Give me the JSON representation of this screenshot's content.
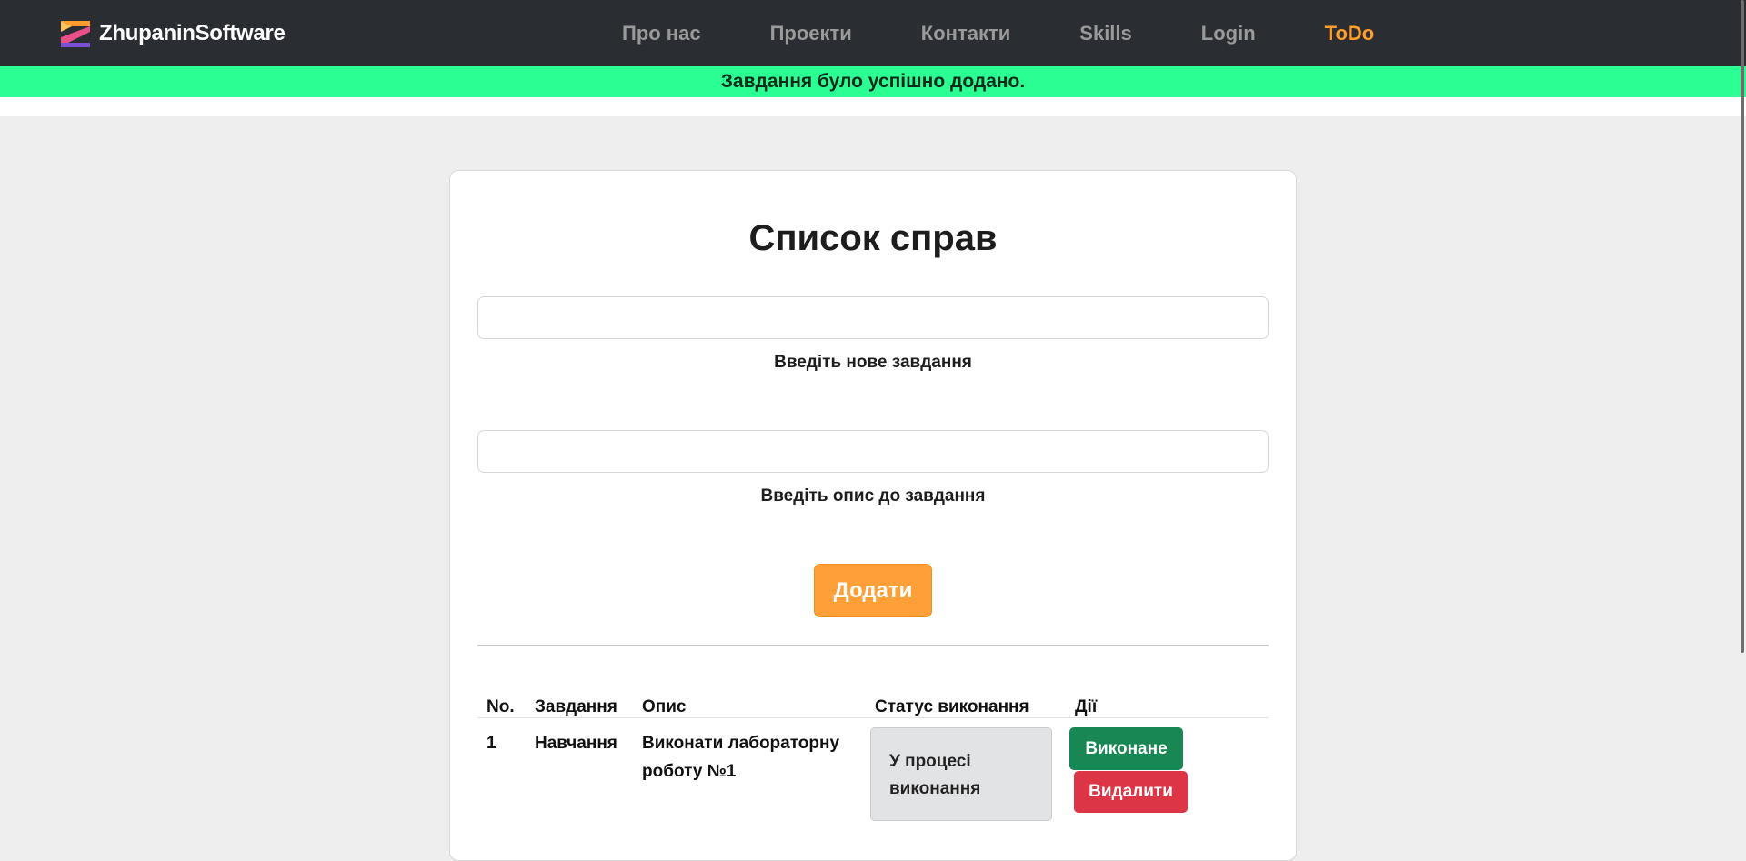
{
  "navbar": {
    "brand": "ZhupaninSoftware",
    "links": [
      {
        "label": "Про нас"
      },
      {
        "label": "Проекти"
      },
      {
        "label": "Контакти"
      },
      {
        "label": "Skills"
      },
      {
        "label": "Login"
      },
      {
        "label": "ToDo",
        "active": true
      }
    ]
  },
  "alert": {
    "message": "Завдання було успішно додано."
  },
  "todo": {
    "title": "Список справ",
    "task_input": {
      "value": "",
      "label": "Введіть нове завдання"
    },
    "description_input": {
      "value": "",
      "label": "Введіть опис до завдання"
    },
    "add_button": "Додати",
    "table": {
      "headers": [
        "No.",
        "Завдання",
        "Опис",
        "Статус виконання",
        "Дії"
      ],
      "rows": [
        {
          "no": "1",
          "task": "Навчання",
          "description": "Виконати лабораторну роботу №1",
          "status": "У процесі виконання",
          "done_button": "Виконане",
          "delete_button": "Видалити"
        }
      ]
    }
  },
  "colors": {
    "navbar_bg": "#2a2e33",
    "nav_link": "#9a9a9a",
    "nav_active": "#ff9e2c",
    "alert_bg": "#2bff93",
    "add_button": "#ff9f38",
    "done_button": "#198754",
    "delete_button": "#dc3545",
    "status_bg": "#e2e3e5"
  }
}
